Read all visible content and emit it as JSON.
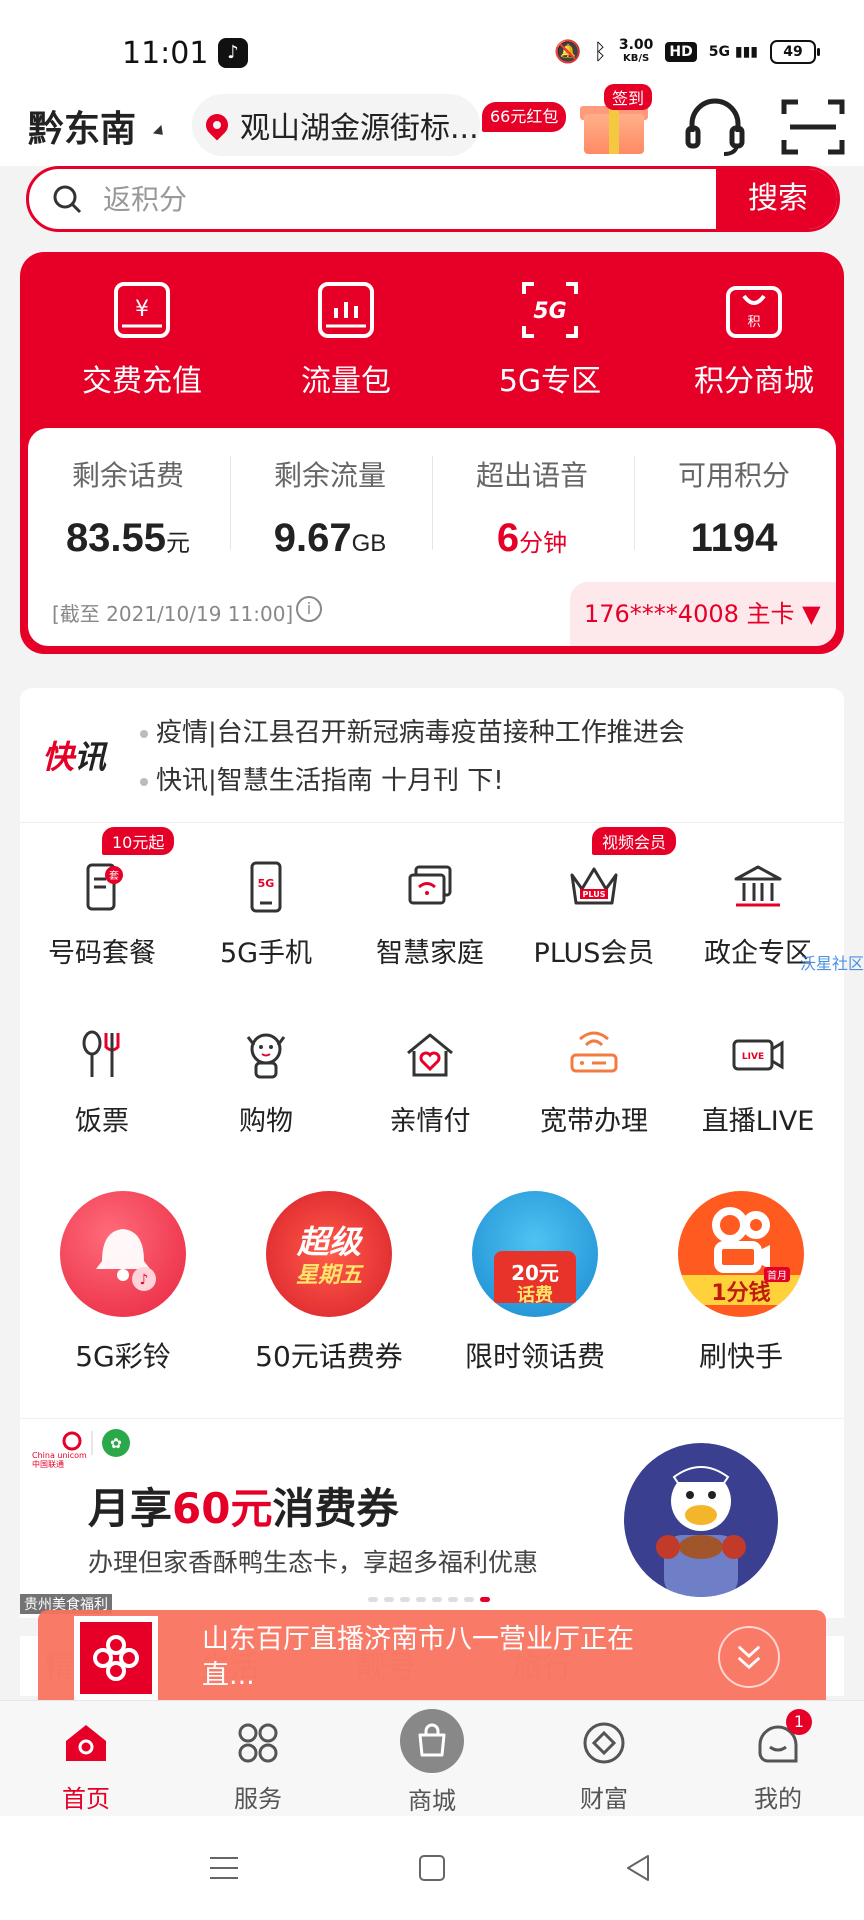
{
  "status_bar": {
    "time": "11:01",
    "net_speed_value": "3.00",
    "net_speed_unit": "KB/S",
    "hd": "HD",
    "signal": "5G",
    "battery": "49"
  },
  "header": {
    "city": "黔东南",
    "location": "观山湖金源街标...",
    "red_packet": "66元红包",
    "sign_in": "签到"
  },
  "search": {
    "placeholder": "返积分",
    "button": "搜索"
  },
  "quick_actions": [
    {
      "label": "交费充值",
      "icon": "yuan-card-icon"
    },
    {
      "label": "流量包",
      "icon": "chart-card-icon"
    },
    {
      "label": "5G专区",
      "icon": "5g-icon"
    },
    {
      "label": "积分商城",
      "icon": "shopping-bag-icon"
    }
  ],
  "balance": {
    "items": [
      {
        "label": "剩余话费",
        "value": "83.55",
        "unit": "元"
      },
      {
        "label": "剩余流量",
        "value": "9.67",
        "unit": "GB"
      },
      {
        "label": "超出语音",
        "value": "6",
        "unit": "分钟"
      },
      {
        "label": "可用积分",
        "value": "1194",
        "unit": ""
      }
    ],
    "as_of": "[截至 2021/10/19 11:00]",
    "info": "i",
    "card": "176****4008 主卡 ▼"
  },
  "news": {
    "title_1": "快",
    "title_2": "讯",
    "items": [
      "疫情|台江县召开新冠病毒疫苗接种工作推进会",
      "快讯|智慧生活指南 十月刊 下!"
    ]
  },
  "services": [
    {
      "label": "号码套餐",
      "tag": "10元起"
    },
    {
      "label": "5G手机",
      "tag": ""
    },
    {
      "label": "智慧家庭",
      "tag": ""
    },
    {
      "label": "PLUS会员",
      "tag": "视频会员"
    },
    {
      "label": "政企专区",
      "tag": ""
    },
    {
      "label": "饭票",
      "tag": ""
    },
    {
      "label": "购物",
      "tag": ""
    },
    {
      "label": "亲情付",
      "tag": ""
    },
    {
      "label": "宽带办理",
      "tag": ""
    },
    {
      "label": "直播LIVE",
      "tag": ""
    }
  ],
  "promos": [
    {
      "label": "5G彩铃",
      "art": ""
    },
    {
      "label": "50元话费券",
      "art_1": "超级",
      "art_2": "星期五"
    },
    {
      "label": "限时领话费",
      "art_1": "20元",
      "art_2": "话费"
    },
    {
      "label": "刷快手",
      "art_1": "1分钱",
      "art_2": "首月"
    }
  ],
  "side_label": "沃星社区",
  "banner": {
    "logo": "China unicom中国联通",
    "title_pre": "月享",
    "title_hl": "60元",
    "title_post": "消费券",
    "subtitle": "办理但家香酥鸭生态卡，享超多福利优惠",
    "corner_tag": "贵州美食福利",
    "dots": 8,
    "active_dot": 7
  },
  "under_tabs": [
    "精",
    "生活",
    "靓号",
    "旅行"
  ],
  "live": {
    "text": "山东百厅直播济南市八一营业厅正在直..."
  },
  "tabbar": [
    {
      "label": "首页",
      "active": true
    },
    {
      "label": "服务",
      "active": false
    },
    {
      "label": "商城",
      "active": false
    },
    {
      "label": "财富",
      "active": false
    },
    {
      "label": "我的",
      "active": false,
      "badge": "1"
    }
  ],
  "colors": {
    "brand": "#e60027",
    "live_bar": "#fa725f"
  }
}
